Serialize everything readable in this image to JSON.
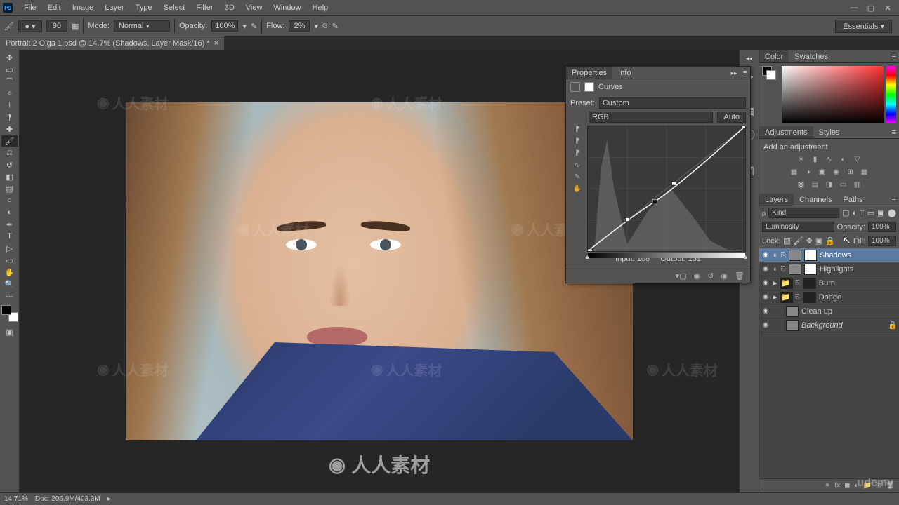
{
  "menubar": {
    "items": [
      "File",
      "Edit",
      "Image",
      "Layer",
      "Type",
      "Select",
      "Filter",
      "3D",
      "View",
      "Window",
      "Help"
    ]
  },
  "optionsbar": {
    "brush_size": "90",
    "mode_label": "Mode:",
    "mode_value": "Normal",
    "opacity_label": "Opacity:",
    "opacity_value": "100%",
    "flow_label": "Flow:",
    "flow_value": "2%",
    "workspace": "Essentials"
  },
  "document": {
    "tab_title": "Portrait 2 Olga 1.psd @ 14.7% (Shadows, Layer Mask/16) *",
    "tab_close": "×"
  },
  "panels": {
    "color": {
      "tab1": "Color",
      "tab2": "Swatches"
    },
    "adjustments": {
      "tab1": "Adjustments",
      "tab2": "Styles",
      "hint": "Add an adjustment"
    },
    "layers": {
      "tab1": "Layers",
      "tab2": "Channels",
      "tab3": "Paths",
      "filter_kind": "Kind",
      "blend_mode": "Luminosity",
      "opacity_label": "Opacity:",
      "opacity_value": "100%",
      "lock_label": "Lock:",
      "fill_label": "Fill:",
      "fill_value": "100%",
      "items": [
        {
          "name": "Shadows",
          "selected": true,
          "curves": true,
          "mask": true
        },
        {
          "name": "Highlights",
          "selected": false,
          "curves": true,
          "mask": true
        },
        {
          "name": "Burn",
          "selected": false,
          "group": true
        },
        {
          "name": "Dodge",
          "selected": false,
          "group": true
        },
        {
          "name": "Clean up",
          "selected": false
        },
        {
          "name": "Background",
          "selected": false,
          "italic": true,
          "locked": true
        }
      ]
    }
  },
  "properties": {
    "tab1": "Properties",
    "tab2": "Info",
    "title": "Curves",
    "preset_label": "Preset:",
    "preset_value": "Custom",
    "channel_value": "RGB",
    "auto": "Auto",
    "input_label": "Input:",
    "input_value": "108",
    "output_label": "Output:",
    "output_value": "101"
  },
  "status": {
    "zoom": "14.71%",
    "doc": "Doc: 206.9M/403.3M"
  },
  "watermark": {
    "text": "人人素材"
  },
  "branding": {
    "udemy": "udemy"
  },
  "chart_data": {
    "type": "line",
    "title": "Curves",
    "xlabel": "Input",
    "ylabel": "Output",
    "xlim": [
      0,
      255
    ],
    "ylim": [
      0,
      255
    ],
    "series": [
      {
        "name": "curve",
        "values": [
          [
            0,
            0
          ],
          [
            108,
            101
          ],
          [
            140,
            140
          ],
          [
            255,
            255
          ]
        ]
      }
    ],
    "histogram_peaks_x": [
      40,
      60,
      150,
      200
    ]
  }
}
